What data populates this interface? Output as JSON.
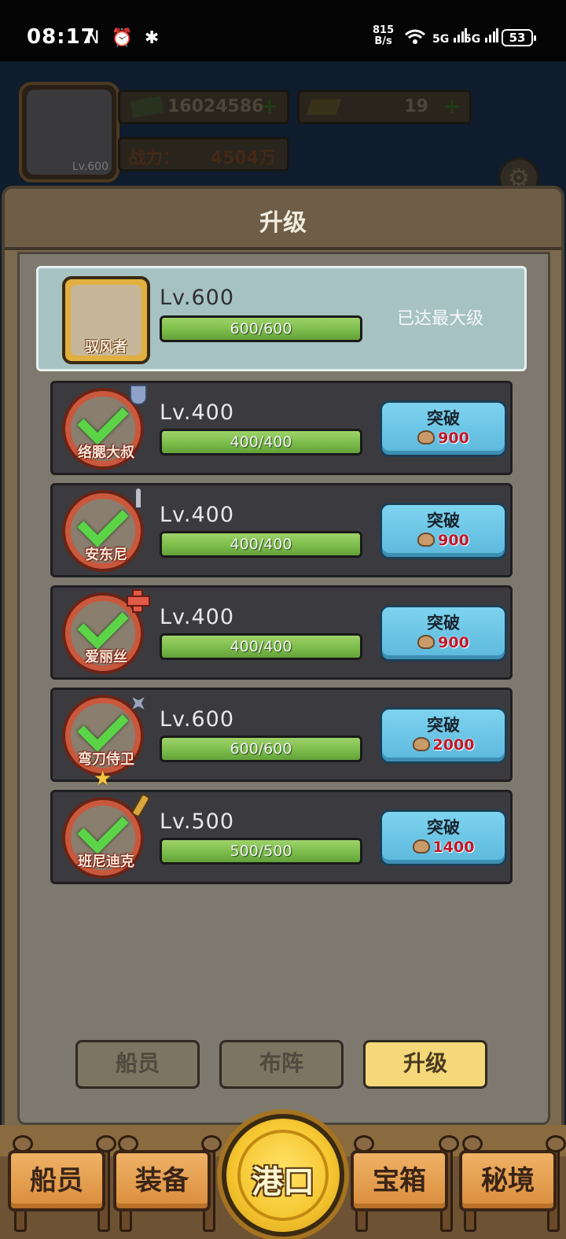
{
  "status_bar": {
    "time": "08:17",
    "left_icons": "N ⏰ ✱",
    "net_speed_value": "815",
    "net_speed_unit": "B/s",
    "signal_1": "5G",
    "signal_2": "5G",
    "battery": "53"
  },
  "header": {
    "player_level": "Lv.600",
    "money": "16024586",
    "gold": "19",
    "power_label": "战力：",
    "power_value": "4504万"
  },
  "panel": {
    "title": "升级",
    "top_hero": {
      "name": "驭风者",
      "level": "Lv.600",
      "exp_text": "600/600",
      "exp_fraction": 1.0,
      "status": "已达最大级"
    },
    "heroes": [
      {
        "name": "络腮大叔",
        "level": "Lv.400",
        "exp_text": "400/400",
        "exp_fraction": 1.0,
        "button_label": "突破",
        "cost": "900",
        "badge": "shield-icon"
      },
      {
        "name": "安东尼",
        "level": "Lv.400",
        "exp_text": "400/400",
        "exp_fraction": 1.0,
        "button_label": "突破",
        "cost": "900",
        "badge": "sword-icon"
      },
      {
        "name": "爱丽丝",
        "level": "Lv.400",
        "exp_text": "400/400",
        "exp_fraction": 1.0,
        "button_label": "突破",
        "cost": "900",
        "badge": "healer-cross-icon"
      },
      {
        "name": "弯刀侍卫",
        "level": "Lv.600",
        "exp_text": "600/600",
        "exp_fraction": 1.0,
        "button_label": "突破",
        "cost": "2000",
        "badge": "shuriken-icon"
      },
      {
        "name": "班尼迪克",
        "level": "Lv.500",
        "exp_text": "500/500",
        "exp_fraction": 1.0,
        "button_label": "突破",
        "cost": "1400",
        "badge": "gold-weapon-icon"
      }
    ],
    "tabs": [
      "船员",
      "布阵",
      "升级"
    ],
    "active_tab": "升级"
  },
  "bottom_nav": {
    "items": [
      "船员",
      "装备",
      "港口",
      "宝箱",
      "秘境"
    ]
  },
  "colors": {
    "bar_fill": "#7fbf4d",
    "break_button": "#6cc6e6",
    "cost_text": "#c0182a",
    "active_tab": "#f4d879",
    "harbor_button": "#f6c832"
  }
}
